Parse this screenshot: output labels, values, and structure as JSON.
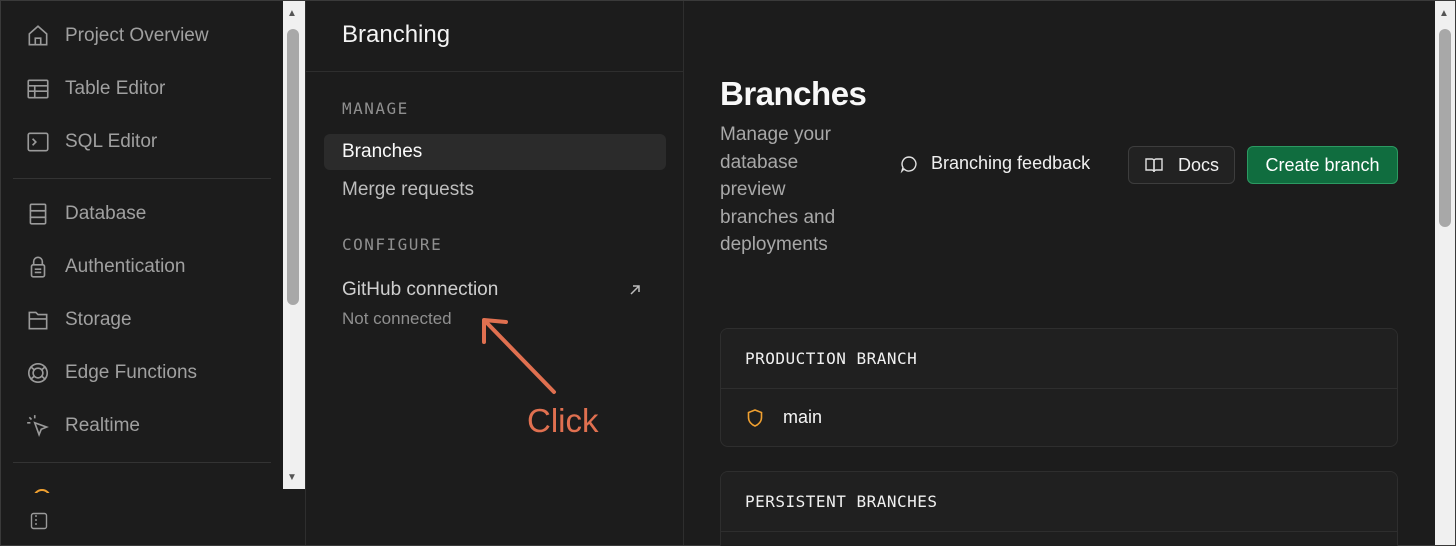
{
  "nav": {
    "items": [
      {
        "label": "Project Overview",
        "icon": "home-icon"
      },
      {
        "label": "Table Editor",
        "icon": "table-icon"
      },
      {
        "label": "SQL Editor",
        "icon": "terminal-icon"
      },
      {
        "label": "Database",
        "icon": "database-icon"
      },
      {
        "label": "Authentication",
        "icon": "lock-icon"
      },
      {
        "label": "Storage",
        "icon": "folder-icon"
      },
      {
        "label": "Edge Functions",
        "icon": "globe-icon"
      },
      {
        "label": "Realtime",
        "icon": "cursor-click-icon"
      }
    ]
  },
  "menu": {
    "title": "Branching",
    "sections": {
      "manage": "MANAGE",
      "configure": "CONFIGURE"
    },
    "items": {
      "branches": "Branches",
      "merge_requests": "Merge requests"
    },
    "github": {
      "label": "GitHub connection",
      "status": "Not connected"
    }
  },
  "annotation": {
    "text": "Click",
    "color": "#e07050"
  },
  "main": {
    "title": "Branches",
    "description": "Manage your database preview branches and deployments",
    "feedback_label": "Branching feedback",
    "docs_label": "Docs",
    "create_label": "Create branch",
    "production": {
      "header": "PRODUCTION BRANCH",
      "branch": "main"
    },
    "persistent": {
      "header": "PERSISTENT BRANCHES"
    }
  },
  "colors": {
    "background": "#1c1c1c",
    "accent_green": "#106d3f",
    "shield_orange": "#f0a030"
  }
}
